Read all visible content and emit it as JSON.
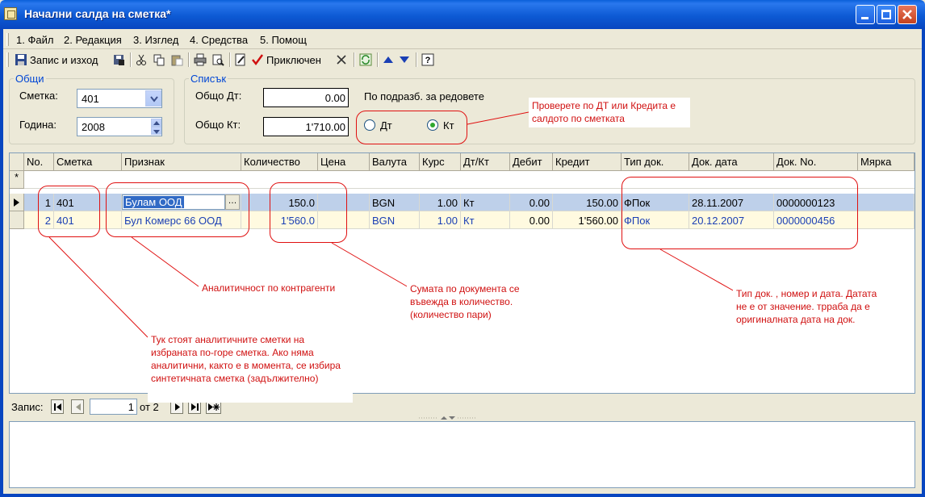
{
  "window": {
    "title": "Начални салда на сметка*"
  },
  "menu": [
    {
      "label": "1. Файл"
    },
    {
      "label": "2. Редакция"
    },
    {
      "label": "3. Изглед"
    },
    {
      "label": "4. Средства"
    },
    {
      "label": "5. Помощ"
    }
  ],
  "toolbar": {
    "save_exit_label": "Запис и изход",
    "closed_label": "Приключен"
  },
  "general": {
    "legend": "Общи",
    "account_label": "Сметка:",
    "account_value": "401",
    "year_label": "Година:",
    "year_value": "2008"
  },
  "list": {
    "legend": "Списък",
    "total_dt_label": "Общо Дт:",
    "total_dt_value": "0.00",
    "total_kt_label": "Общо Кт:",
    "total_kt_value": "1'710.00",
    "by_sub_label": "По подразб. за редовете",
    "radio_dt_label": "Дт",
    "radio_kt_label": "Кт",
    "selected": "Кт"
  },
  "grid": {
    "columns": [
      "No.",
      "Сметка",
      "Признак",
      "Количество",
      "Цена",
      "Валута",
      "Курс",
      "Дт/Кт",
      "Дебит",
      "Кредит",
      "Тип док.",
      "Док. дата",
      "Док. No.",
      "Мярка"
    ],
    "new_row_marker": "*",
    "rows": [
      {
        "no": "1",
        "account": "401",
        "sign": "Булам ООД",
        "qty": "150.0",
        "price": "",
        "currency": "BGN",
        "rate": "1.00",
        "dtkt": "Кт",
        "debit": "0.00",
        "credit": "150.00",
        "doc_type": "ФПок",
        "doc_date": "28.11.2007",
        "doc_no": "0000000123",
        "unit": ""
      },
      {
        "no": "2",
        "account": "401",
        "sign": "Бул Комерс 66 ООД",
        "qty": "1'560.0",
        "price": "",
        "currency": "BGN",
        "rate": "1.00",
        "dtkt": "Кт",
        "debit": "0.00",
        "credit": "1'560.00",
        "doc_type": "ФПок",
        "doc_date": "20.12.2007",
        "doc_no": "0000000456",
        "unit": ""
      }
    ]
  },
  "navigator": {
    "label": "Запис:",
    "current": "1",
    "of_label": "от 2"
  },
  "notes": {
    "check": "Проверете по ДТ или Кредита е салдото по сметката",
    "analytic": "Аналитичност по контрагенти",
    "sum": "Сумата по документа се въвежда в количество. (количество пари)",
    "doc": "Тип док. , номер и дата. Датата не е от значение. трраба да е оригиналната дата на док.",
    "accounts": "Тук стоят аналитичните сметки на избраната по-горе сметка. Ако няма аналитични, както е в момента, се избира синтетичната сметка (задължително)"
  }
}
